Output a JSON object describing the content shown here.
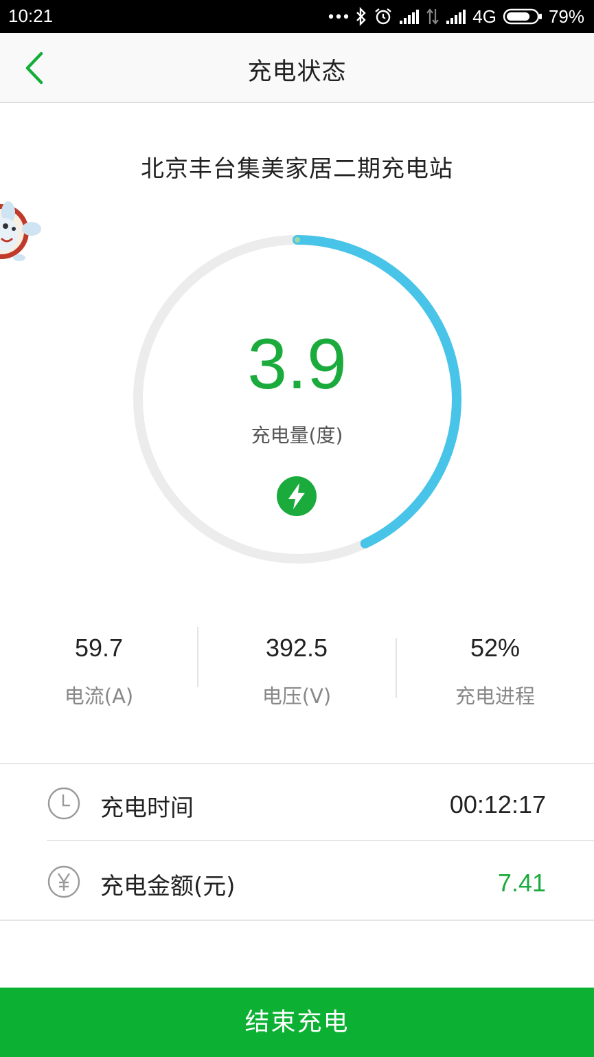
{
  "status_bar": {
    "time": "10:21",
    "network": "4G",
    "battery": "79%",
    "battery_level": 0.79
  },
  "nav": {
    "title": "充电状态"
  },
  "station": {
    "name": "北京丰台集美家居二期充电站"
  },
  "gauge": {
    "value": "3.9",
    "label": "充电量(度)",
    "progress": 0.43,
    "track_color": "#ececec",
    "progress_color": "#48c4e8",
    "accent_color": "#1aab3c"
  },
  "stats": [
    {
      "value": "59.7",
      "label": "电流(A)"
    },
    {
      "value": "392.5",
      "label": "电压(V)"
    },
    {
      "value": "52%",
      "label": "充电进程"
    }
  ],
  "info": {
    "time": {
      "label": "充电时间",
      "value": "00:12:17",
      "icon": "clock-icon"
    },
    "amount": {
      "label": "充电金额(元)",
      "value": "7.41",
      "icon": "yuan-icon",
      "value_color": "#1aab3c"
    }
  },
  "actions": {
    "end_label": "结束充电",
    "button_color": "#0cb133"
  }
}
